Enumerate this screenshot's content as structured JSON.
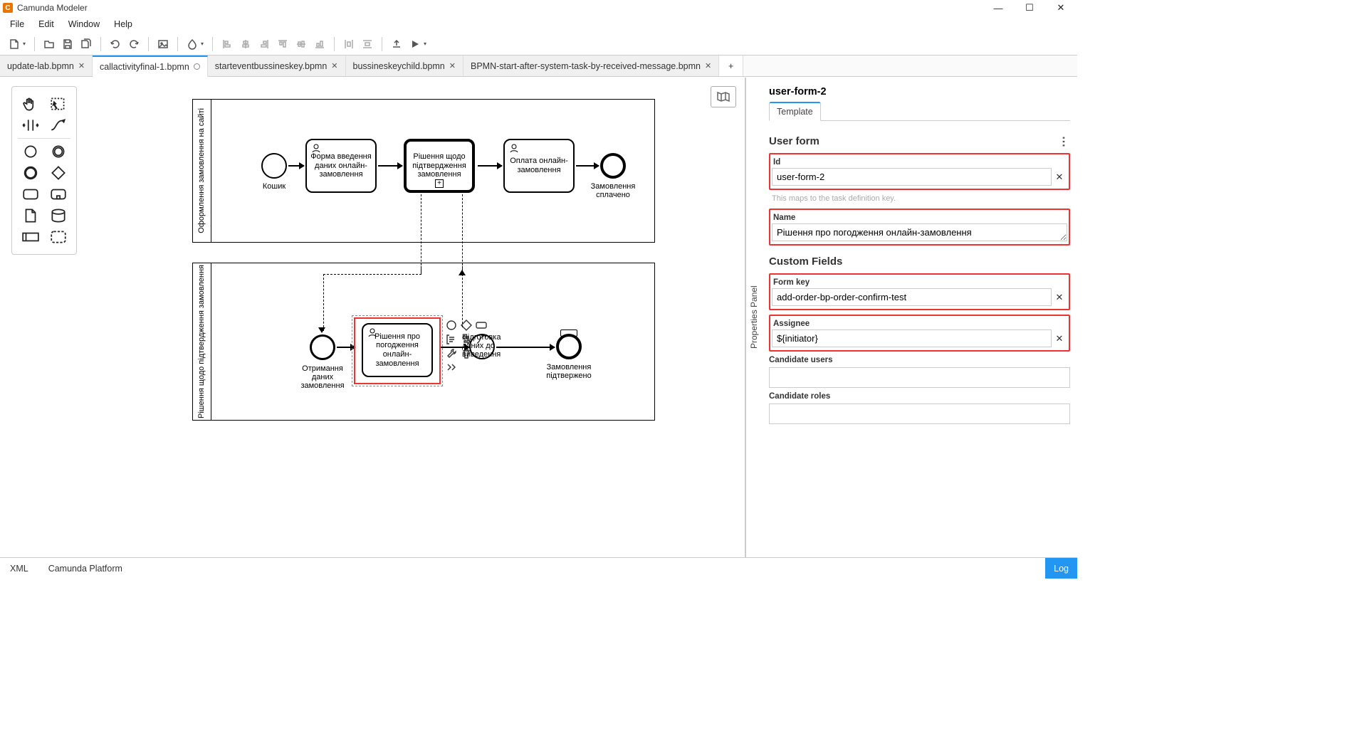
{
  "app": {
    "title": "Camunda Modeler",
    "icon_letter": "C"
  },
  "menu": [
    "File",
    "Edit",
    "Window",
    "Help"
  ],
  "tabs": [
    {
      "name": "update-lab.bpmn",
      "active": false,
      "dirty": false
    },
    {
      "name": "callactivityfinal-1.bpmn",
      "active": true,
      "dirty": true
    },
    {
      "name": "starteventbussineskey.bpmn",
      "active": false,
      "dirty": false
    },
    {
      "name": "bussineskeychild.bpmn",
      "active": false,
      "dirty": false
    },
    {
      "name": "BPMN-start-after-system-task-by-received-message.bpmn",
      "active": false,
      "dirty": false
    }
  ],
  "pool1": {
    "title": "Оформлення замовлення на сайті",
    "start_label": "Кошик",
    "task1": "Форма введення даних онлайн-замовлення",
    "task2": "Рішення щодо підтвердження замовлення",
    "task3": "Оплата онлайн-замовлення",
    "end_label": "Замовлення сплачено"
  },
  "pool2": {
    "title": "Рішення щодо підтвердження замовлення",
    "start_label": "Отримання даних замовлення",
    "task_sel": "Рішення про погодження онлайн-замовлення",
    "task_prep": "Підготовка даних до виведення",
    "end_label": "Замовлення підтвержено"
  },
  "panel": {
    "vert_tab": "Properties Panel",
    "title": "user-form-2",
    "tab": "Template",
    "section1": "User form",
    "id_label": "Id",
    "id_value": "user-form-2",
    "id_hint": "This maps to the task definition key.",
    "name_label": "Name",
    "name_value": "Рішення про погодження онлайн-замовлення",
    "section2": "Custom Fields",
    "formkey_label": "Form key",
    "formkey_value": "add-order-bp-order-confirm-test",
    "assignee_label": "Assignee",
    "assignee_value": "${initiator}",
    "cand_users_label": "Candidate users",
    "cand_roles_label": "Candidate roles"
  },
  "statusbar": {
    "xml": "XML",
    "platform": "Camunda Platform",
    "log": "Log"
  }
}
